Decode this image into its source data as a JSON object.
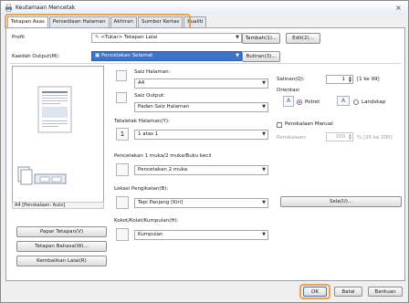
{
  "window": {
    "title": "Keutamaan Mencetak",
    "close": "×"
  },
  "tabs": [
    {
      "label": "Tetapan Asas"
    },
    {
      "label": "Persediaan Halaman"
    },
    {
      "label": "Akhiran"
    },
    {
      "label": "Sumber Kertas"
    },
    {
      "label": "Kualiti"
    }
  ],
  "profile": {
    "label": "Profil",
    "value": "<Tukar> Tetapan Lalai",
    "add_label": "Tambah(1)...",
    "edit_label": "Edit(2)..."
  },
  "output": {
    "label": "Kaedah Output(M):",
    "value": "Pencetakan Selamat",
    "details_label": "Butiran(3)..."
  },
  "page_size": {
    "label": "Saiz Halaman:",
    "value": "A4"
  },
  "output_size": {
    "label": "Saiz Output:",
    "value": "Padan Saiz Halaman"
  },
  "layout": {
    "label": "Tataletak Halaman(Y):",
    "value": "1 atas 1"
  },
  "duplex": {
    "label": "Pencetakan 1 muka/2 muka/Buku kecil",
    "value": "Pencetakan 2 muka"
  },
  "binding": {
    "label": "Lokasi Pengikatan(B):",
    "value": "Tepi Panjang [Kiri]"
  },
  "collate": {
    "label": "Kokot/Kolat/Kumpulan(H):",
    "value": "Kumpulan"
  },
  "copies": {
    "label": "Salinan(Q):",
    "value": "1",
    "range": "[1 ke 99]"
  },
  "orientation": {
    "label": "Orientasi",
    "portrait": "Potret",
    "landscape": "Landskap",
    "selected": "Potret"
  },
  "scaling": {
    "label": "Penskalaan Manual",
    "sub_label": "Penskalaan:",
    "value": "100",
    "range": "% [25 ke 200]",
    "checked": false
  },
  "preview": {
    "status": "A4 [Penskalaan: Auto]"
  },
  "left_buttons": {
    "view_settings": "Papar Tetapan(V)",
    "language_settings": "Tetapan Bahasa(W)...",
    "restore_defaults": "Kembalikan Lalai(R)"
  },
  "settings_button": "Sela(U)...",
  "footer": {
    "ok": "OK",
    "cancel": "Batal",
    "help": "Bantuan"
  },
  "colors": {
    "highlight": "#f0a24a",
    "selection": "#3a73c9"
  }
}
